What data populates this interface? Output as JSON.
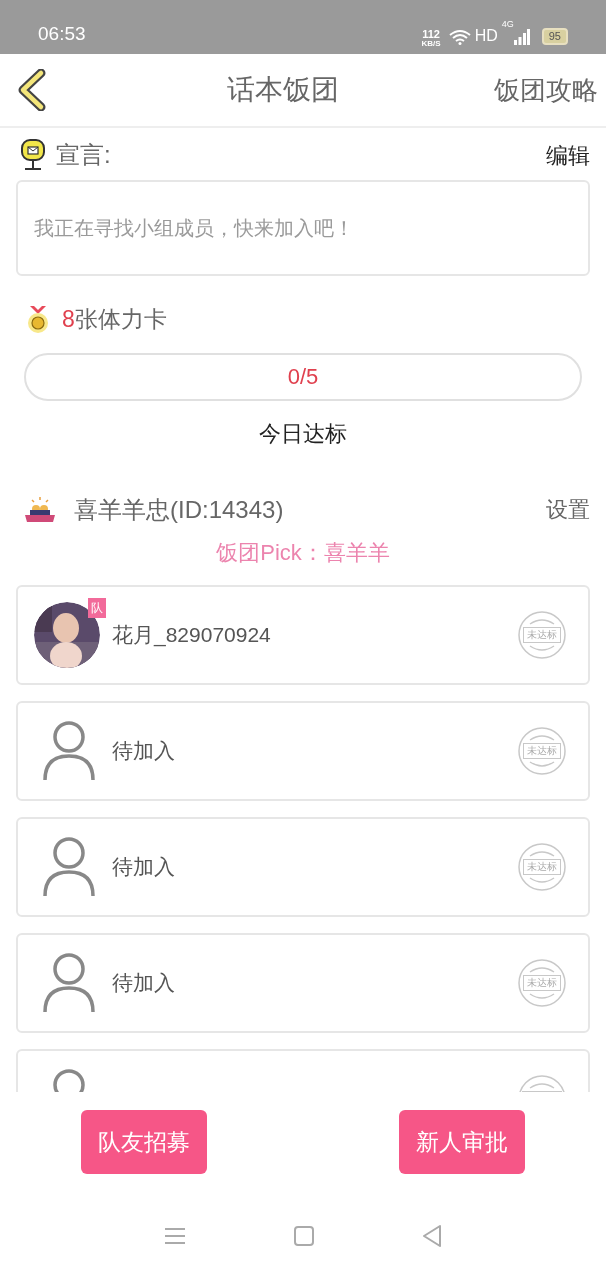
{
  "status_bar": {
    "time": "06:53",
    "speed": "112",
    "speed_unit": "KB/S",
    "hd": "HD",
    "network": "4G",
    "battery": "95"
  },
  "header": {
    "title": "话本饭团",
    "action": "饭团攻略"
  },
  "declaration": {
    "label": "宣言:",
    "edit": "编辑",
    "placeholder": "我正在寻找小组成员，快来加入吧！"
  },
  "cards": {
    "count": "8",
    "label": "张体力卡"
  },
  "progress": {
    "reading": "0/5",
    "caption": "今日达标"
  },
  "team": {
    "name": "喜羊羊忠(ID:14343)",
    "settings": "设置",
    "pick": "饭团Pick：喜羊羊"
  },
  "members": [
    {
      "kind": "member",
      "name": "花月_829070924",
      "badge": "队",
      "stamp": "未达标"
    },
    {
      "kind": "empty",
      "name": "待加入",
      "stamp": "未达标"
    },
    {
      "kind": "empty",
      "name": "待加入",
      "stamp": "未达标"
    },
    {
      "kind": "empty",
      "name": "待加入",
      "stamp": "未达标"
    },
    {
      "kind": "empty"
    }
  ],
  "buttons": [
    "队友招募",
    "新人审批"
  ]
}
